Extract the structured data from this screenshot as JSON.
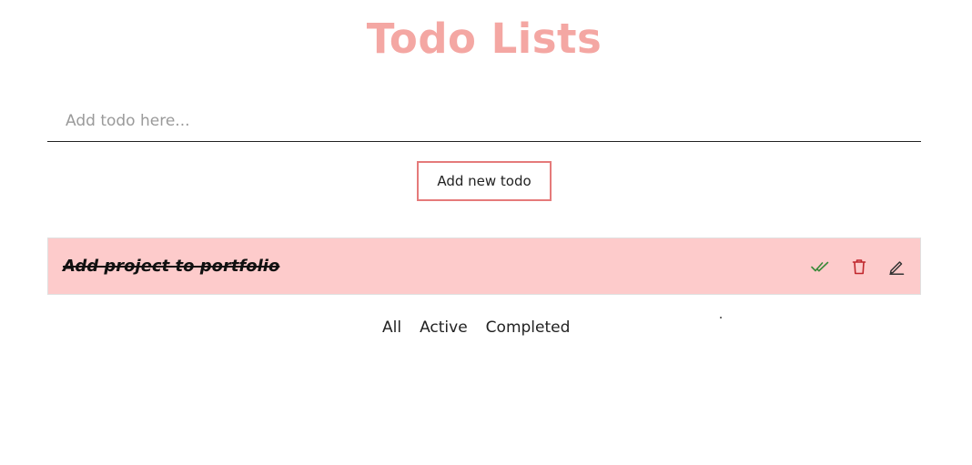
{
  "header": {
    "title": "Todo Lists"
  },
  "new_todo": {
    "placeholder": "Add todo here...",
    "value": "",
    "button_label": "Add new todo"
  },
  "todos": [
    {
      "text": "Add project to portfolio",
      "completed": true,
      "actions": {
        "complete_icon": "double-check-icon",
        "delete_icon": "trash-icon",
        "edit_icon": "pencil-icon"
      }
    }
  ],
  "filters": {
    "all_label": "All",
    "active_label": "Active",
    "completed_label": "Completed"
  },
  "colors": {
    "title": "#f4a7a3",
    "completed_row_bg": "#fdcbcb",
    "button_border": "#e57a7a",
    "check_icon": "#3a8a3a",
    "trash_icon": "#c0262c",
    "edit_icon": "#333333"
  }
}
